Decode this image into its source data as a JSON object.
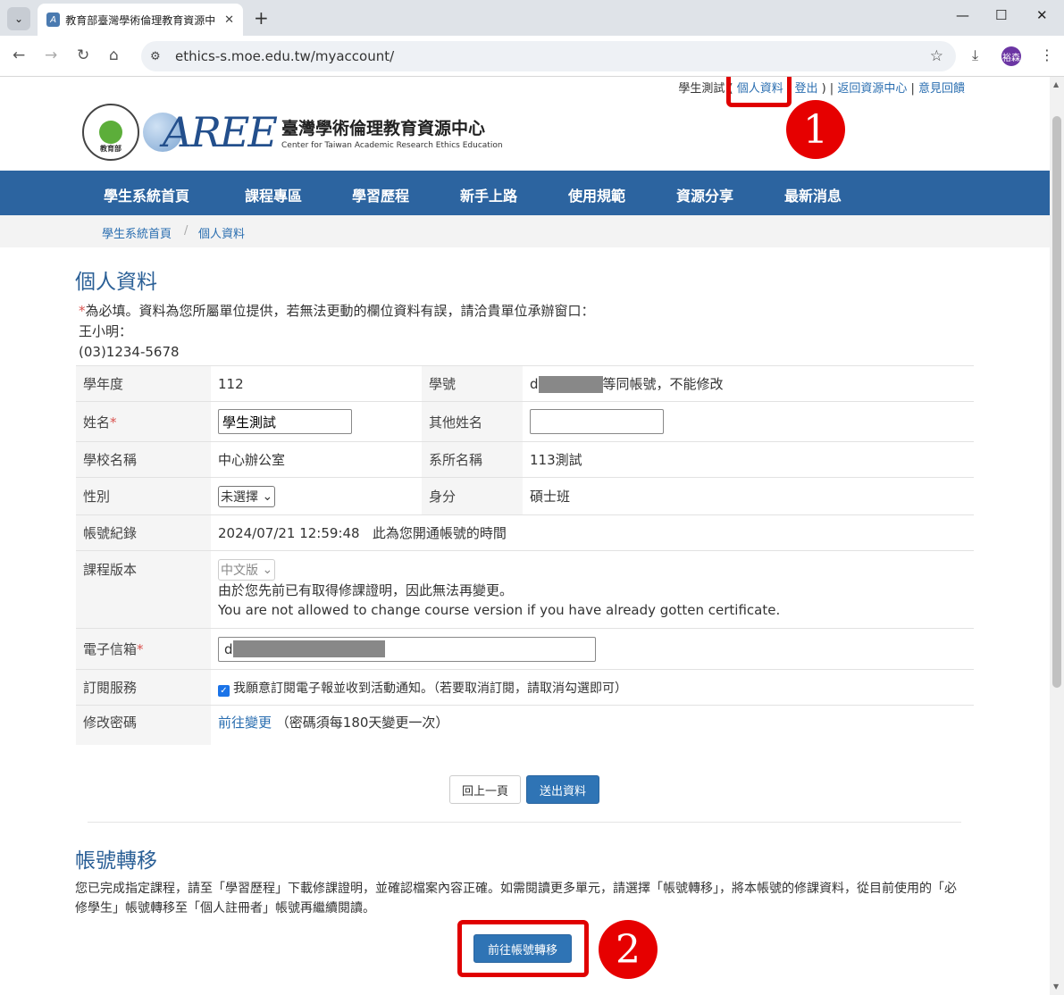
{
  "browser": {
    "tab_title": "教育部臺灣學術倫理教育資源中",
    "url": "ethics-s.moe.edu.tw/myaccount/",
    "avatar_label": "裕森"
  },
  "header": {
    "user_name": "學生測試",
    "profile_link": "個人資料",
    "logout_link": "登出",
    "back_link": "返回資源中心",
    "feedback_link": "意見回饋",
    "logo_zh": "臺灣學術倫理教育資源中心",
    "logo_en": "Center for Taiwan Academic Research Ethics Education",
    "logo_mark": "AREE",
    "seal_text": "教育部",
    "seal_ring_text": "MINISTRY OF EDUCATION"
  },
  "nav": {
    "items": [
      "學生系統首頁",
      "課程專區",
      "學習歷程",
      "新手上路",
      "使用規範",
      "資源分享",
      "最新消息"
    ]
  },
  "breadcrumb": {
    "home": "學生系統首頁",
    "separator": "/",
    "current": "個人資料"
  },
  "profile": {
    "title": "個人資料",
    "notice_star": "*",
    "notice_text": "為必填。資料為您所屬單位提供，若無法更動的欄位資料有誤，請洽貴單位承辦窗口：",
    "contact_name": "王小明：",
    "contact_phone": "(03)1234-5678",
    "fields": {
      "year_label": "學年度",
      "year_value": "112",
      "student_id_label": "學號",
      "student_id_prefix": "d",
      "student_id_note": "等同帳號，不能修改",
      "name_label": "姓名",
      "name_value": "學生測試",
      "other_name_label": "其他姓名",
      "other_name_value": "",
      "school_label": "學校名稱",
      "school_value": "中心辦公室",
      "dept_label": "系所名稱",
      "dept_value": "113測試",
      "gender_label": "性別",
      "gender_value": "未選擇",
      "identity_label": "身分",
      "identity_value": "碩士班",
      "account_label": "帳號紀錄",
      "account_value": "2024/07/21 12:59:48",
      "account_note": "此為您開通帳號的時間",
      "version_label": "課程版本",
      "version_value": "中文版",
      "version_note_zh": "由於您先前已有取得修課證明，因此無法再變更。",
      "version_note_en": "You are not allowed to change course version if you have already gotten certificate.",
      "email_label": "電子信箱",
      "email_prefix": "d",
      "subscribe_label": "訂閱服務",
      "subscribe_text": "我願意訂閱電子報並收到活動通知。（若要取消訂閱，請取消勾選即可）",
      "password_label": "修改密碼",
      "password_link": "前往變更",
      "password_note": "（密碼須每180天變更一次）"
    },
    "back_button": "回上一頁",
    "submit_button": "送出資料"
  },
  "transfer": {
    "title": "帳號轉移",
    "description": "您已完成指定課程，請至「學習歷程」下載修課證明，並確認檔案內容正確。如需閱讀更多單元，請選擇「帳號轉移」，將本帳號的修課資料，從目前使用的「必修學生」帳號轉移至「個人註冊者」帳號再繼續閱讀。",
    "button": "前往帳號轉移"
  },
  "annotations": {
    "marker_1": "1",
    "marker_2": "2",
    "highlight_color": "#e00000"
  },
  "colors": {
    "nav_bg": "#2c64a0",
    "heading": "#2a5f96",
    "link": "#2a6eb0",
    "primary_button": "#2f74b5"
  }
}
